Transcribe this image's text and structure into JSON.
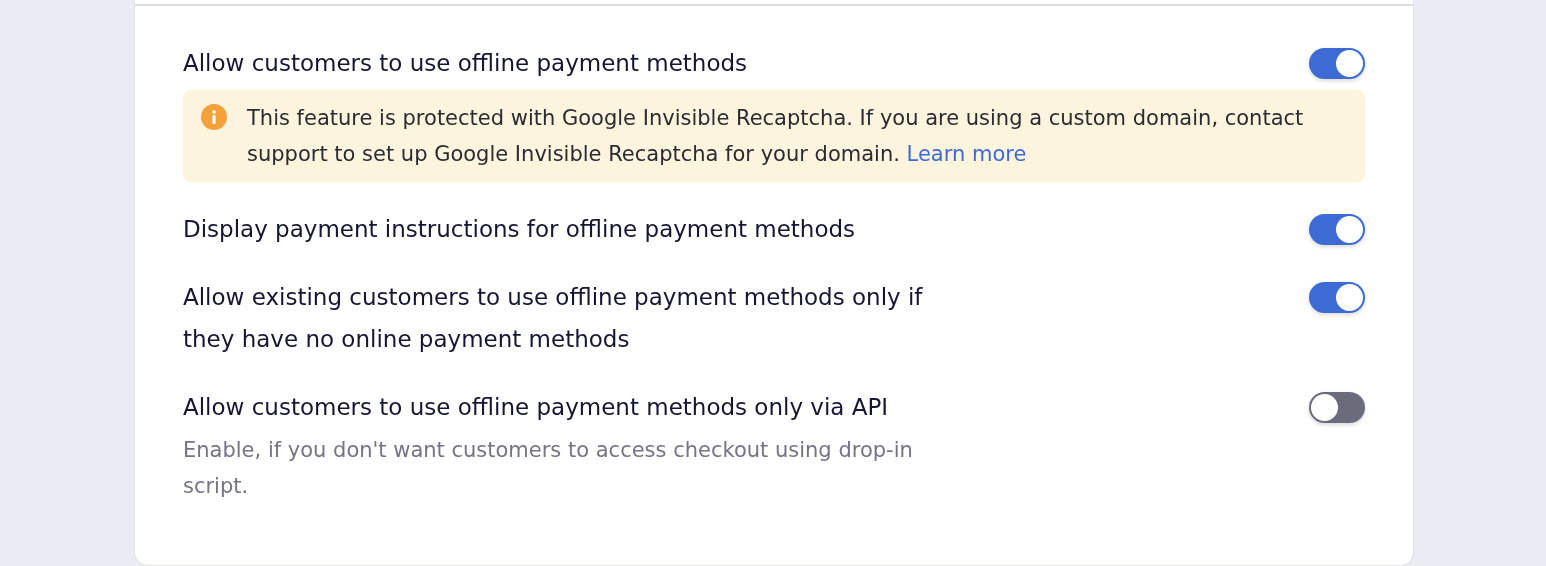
{
  "settings": [
    {
      "label": "Allow customers to use offline payment methods",
      "on": true,
      "notice": {
        "text": "This feature is protected with Google Invisible Recaptcha. If you are using a custom domain, contact support to set up Google Invisible Recaptcha for your domain.",
        "link": "Learn more"
      }
    },
    {
      "label": "Display payment instructions for offline payment methods",
      "on": true
    },
    {
      "label": "Allow existing customers to use offline payment methods only if they have no online payment methods",
      "on": true
    },
    {
      "label": "Allow customers to use offline payment methods only via API",
      "on": false,
      "description": "Enable, if you don't want customers to access checkout using drop-in script."
    }
  ]
}
